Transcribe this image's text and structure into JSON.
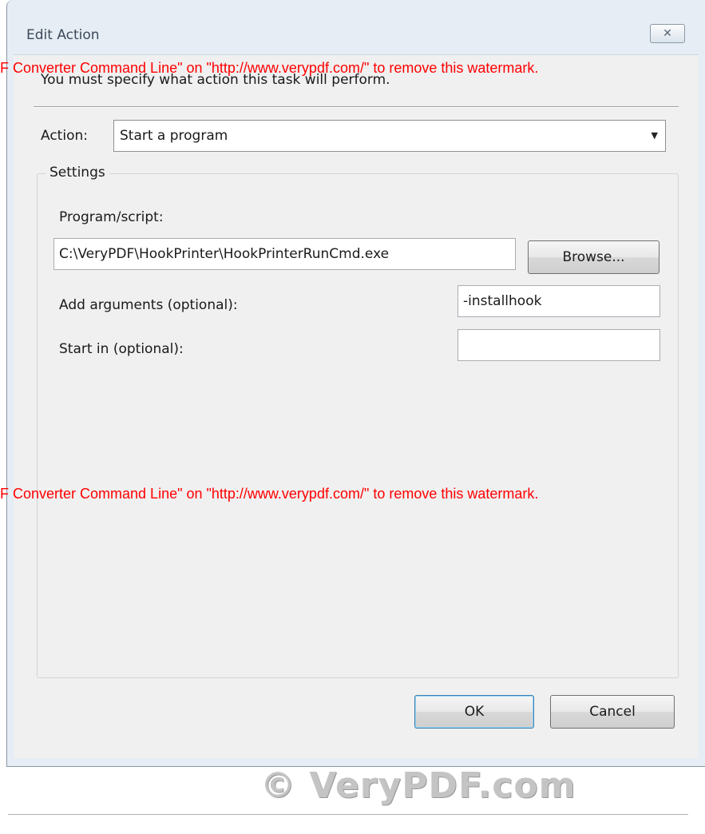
{
  "window": {
    "title": "Edit Action",
    "close_glyph": "✕"
  },
  "description": "You must specify what action this task will perform.",
  "action": {
    "label": "Action:",
    "selected": "Start a program",
    "dropdown_icon": "chevron-down-icon"
  },
  "settings": {
    "legend": "Settings",
    "program_label": "Program/script:",
    "program_value": "C:\\VeryPDF\\HookPrinter\\HookPrinterRunCmd.exe",
    "browse_label": "Browse...",
    "arguments_label": "Add arguments (optional):",
    "arguments_value": "-installhook",
    "start_in_label": "Start in (optional):",
    "start_in_value": ""
  },
  "buttons": {
    "ok": "OK",
    "cancel": "Cancel"
  },
  "watermark": {
    "line1": "F Converter Command Line\" on \"http://www.verypdf.com/\" to remove this watermark.",
    "line2": "F Converter Command Line\" on \"http://www.verypdf.com/\" to remove this watermark.",
    "color": "#ff0000"
  },
  "logo": "© VeryPDF.com"
}
